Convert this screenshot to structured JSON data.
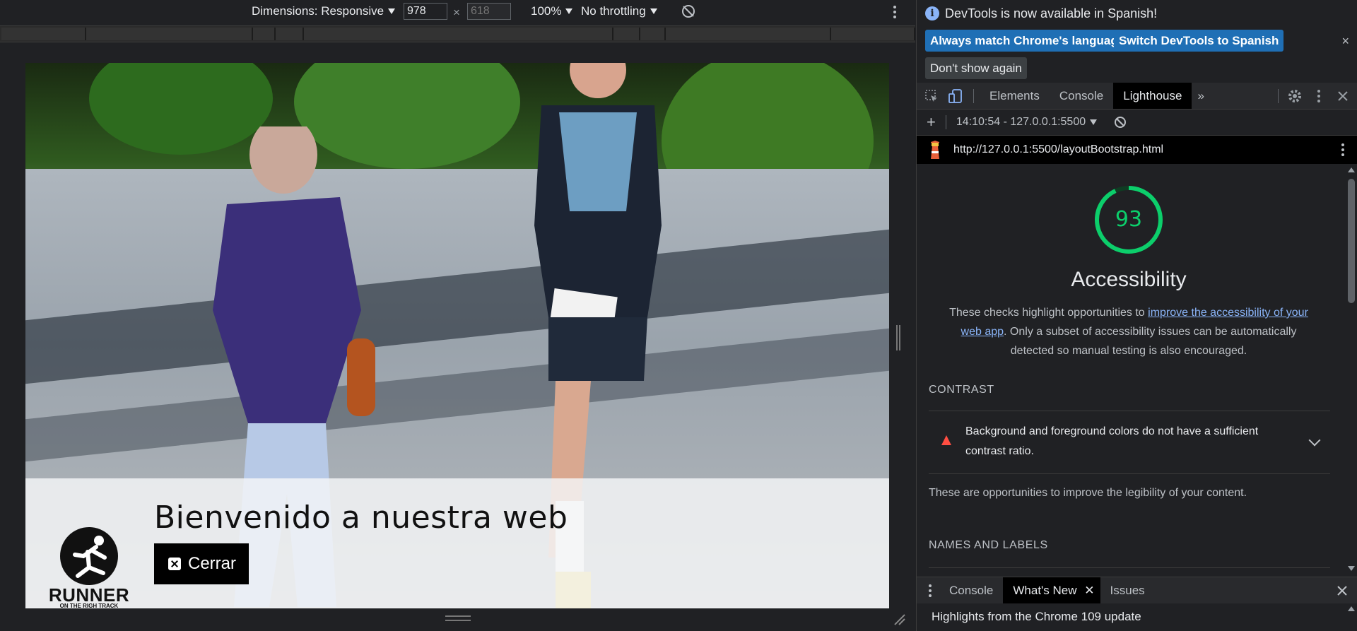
{
  "device_toolbar": {
    "dimensions_label": "Dimensions: Responsive",
    "width_value": "978",
    "times": "×",
    "height_placeholder": "618",
    "zoom": "100%",
    "throttling": "No throttling"
  },
  "page": {
    "welcome_heading": "Bienvenido a nuestra web",
    "close_button": "Cerrar",
    "logo_name": "RUNNER",
    "logo_tagline": "ON THE RIGH TRACK"
  },
  "infobar": {
    "message": "DevTools is now available in Spanish!",
    "btn_match": "Always match Chrome's language",
    "btn_switch": "Switch DevTools to Spanish",
    "btn_dont_show": "Don't show again",
    "close": "×"
  },
  "tabs": {
    "elements": "Elements",
    "console": "Console",
    "lighthouse": "Lighthouse",
    "more": "»"
  },
  "lighthouse": {
    "add": "+",
    "report_selector": "14:10:54 - 127.0.0.1:5500",
    "url": "http://127.0.0.1:5500/layoutBootstrap.html",
    "score": "93",
    "score_color": "#0cce6b",
    "category_title": "Accessibility",
    "desc_before": "These checks highlight opportunities to ",
    "desc_link": "improve the accessibility of your web app",
    "desc_after": ". Only a subset of accessibility issues can be automatically detected so manual testing is also encouraged.",
    "group_contrast": "CONTRAST",
    "audit_contrast": "Background and foreground colors do not have a sufficient contrast ratio.",
    "group_contrast_desc": "These are opportunities to improve the legibility of your content.",
    "group_names": "NAMES AND LABELS"
  },
  "drawer": {
    "console": "Console",
    "whats_new": "What's New",
    "issues": "Issues",
    "content": "Highlights from the Chrome 109 update"
  },
  "colors": {
    "accent_button": "#1f6fb5",
    "pass": "#0cce6b",
    "fail": "#ff4e42",
    "link": "#8ab4f8"
  }
}
